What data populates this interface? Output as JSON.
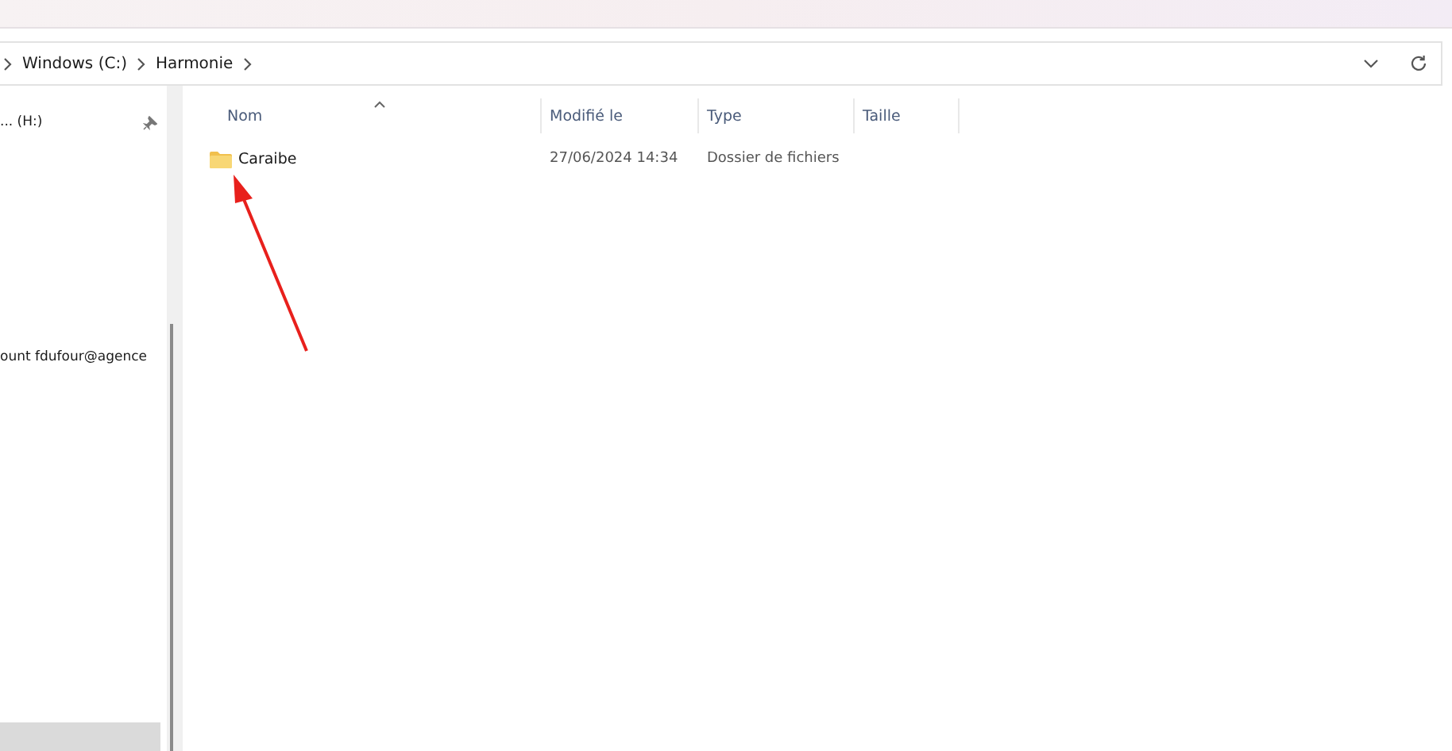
{
  "address_bar": {
    "breadcrumbs": [
      "Windows (C:)",
      "Harmonie"
    ]
  },
  "sidebar": {
    "items": [
      {
        "label": "... (H:)",
        "pinned": true
      },
      {
        "label": "ount fdufour@agence",
        "pinned": false
      }
    ]
  },
  "file_list": {
    "columns": [
      {
        "label": "Nom",
        "sorted": true
      },
      {
        "label": "Modifié le",
        "sorted": false
      },
      {
        "label": "Type",
        "sorted": false
      },
      {
        "label": "Taille",
        "sorted": false
      }
    ],
    "rows": [
      {
        "name": "Caraibe",
        "modified": "27/06/2024 14:34",
        "type": "Dossier de fichiers",
        "size": null
      }
    ]
  }
}
